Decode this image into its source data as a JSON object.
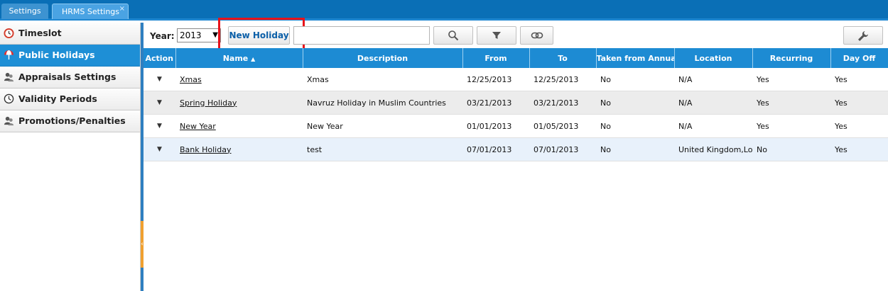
{
  "tabs": [
    {
      "label": "Settings"
    },
    {
      "label": "HRMS Settings",
      "close": "×"
    }
  ],
  "sidebar": {
    "items": [
      {
        "label": "Timeslot",
        "icon": "clock-alarm-icon",
        "active": false
      },
      {
        "label": "Public Holidays",
        "icon": "beach-umbrella-icon",
        "active": true
      },
      {
        "label": "Appraisals Settings",
        "icon": "users-icon",
        "active": false
      },
      {
        "label": "Validity Periods",
        "icon": "clock-icon",
        "active": false
      },
      {
        "label": "Promotions/Penalties",
        "icon": "users-icon",
        "active": false
      }
    ]
  },
  "toolbar": {
    "year_label": "Year:",
    "year_value": "2013",
    "new_holiday_label": "New Holiday",
    "search_value": ""
  },
  "table": {
    "columns": [
      "Action",
      "Name",
      "Description",
      "From",
      "To",
      "Taken from Annual",
      "Location",
      "Recurring",
      "Day Off"
    ],
    "sort_indicator": "▲",
    "rows": [
      {
        "action": "▼",
        "name": "Xmas",
        "description": "Xmas",
        "from": "12/25/2013",
        "to": "12/25/2013",
        "taken": "No",
        "location": "N/A",
        "recurring": "Yes",
        "dayoff": "Yes"
      },
      {
        "action": "▼",
        "name": "Spring Holiday",
        "description": "Navruz Holiday in Muslim Countries",
        "from": "03/21/2013",
        "to": "03/21/2013",
        "taken": "No",
        "location": "N/A",
        "recurring": "Yes",
        "dayoff": "Yes"
      },
      {
        "action": "▼",
        "name": "New Year",
        "description": "New Year",
        "from": "01/01/2013",
        "to": "01/05/2013",
        "taken": "No",
        "location": "N/A",
        "recurring": "Yes",
        "dayoff": "Yes"
      },
      {
        "action": "▼",
        "name": "Bank Holiday",
        "description": "test",
        "from": "07/01/2013",
        "to": "07/01/2013",
        "taken": "No",
        "location": "United Kingdom,Londo",
        "recurring": "No",
        "dayoff": "Yes"
      }
    ]
  },
  "colors": {
    "brand": "#0a6fb6",
    "header": "#1d8bd3",
    "active_nav": "#1e8fd6",
    "highlight": "#e8131b"
  }
}
